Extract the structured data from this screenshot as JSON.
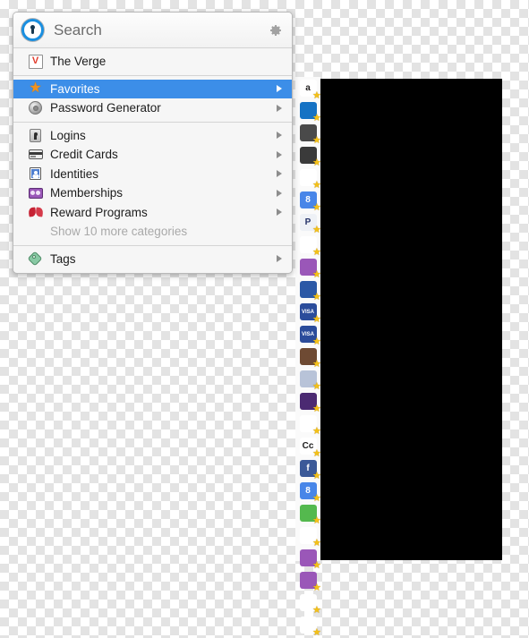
{
  "window": {
    "title": "1Password mini",
    "black_panel_label": "browser-content-area"
  },
  "search": {
    "label": "Search",
    "placeholder": "Search",
    "logo_icon": "1password-logo-icon",
    "settings_icon": "gear-icon"
  },
  "colors": {
    "selection": "#3c8ee8",
    "panel_background": "#f6f6f6",
    "panel_border": "#b9b9b9",
    "muted_text": "#a9a9a9",
    "text": "#1c1c1c",
    "star_badge": "#f5c116"
  },
  "menu": {
    "recent": [
      {
        "label": "The Verge",
        "icon": "verge-icon",
        "has_submenu": false,
        "selected": false
      }
    ],
    "shortcuts": [
      {
        "label": "Favorites",
        "icon": "star-icon",
        "has_submenu": true,
        "selected": true
      },
      {
        "label": "Password Generator",
        "icon": "dial-icon",
        "has_submenu": true,
        "selected": false
      }
    ],
    "categories": [
      {
        "label": "Logins",
        "icon": "lock-icon",
        "has_submenu": true,
        "selected": false
      },
      {
        "label": "Credit Cards",
        "icon": "credit-card-icon",
        "has_submenu": true,
        "selected": false
      },
      {
        "label": "Identities",
        "icon": "identity-icon",
        "has_submenu": true,
        "selected": false
      },
      {
        "label": "Memberships",
        "icon": "membership-icon",
        "has_submenu": true,
        "selected": false
      },
      {
        "label": "Reward Programs",
        "icon": "bow-icon",
        "has_submenu": true,
        "selected": false
      }
    ],
    "show_more": {
      "label": "Show 10 more categories"
    },
    "tags": [
      {
        "label": "Tags",
        "icon": "tag-icon",
        "has_submenu": true,
        "selected": false
      }
    ]
  },
  "icon_strip": {
    "name": "favorites-icon-strip",
    "items": [
      {
        "name": "amazon-icon",
        "glyph": "a",
        "bg": "#ffffff",
        "fg": "#221f1f",
        "favorite": true
      },
      {
        "name": "amex-icon",
        "glyph": "",
        "bg": "#1572c4",
        "fg": "#ffffff",
        "favorite": true
      },
      {
        "name": "apple-store-icon",
        "glyph": "",
        "bg": "#4a4a4a",
        "fg": "#ffffff",
        "favorite": true
      },
      {
        "name": "bank-icon",
        "glyph": "",
        "bg": "#3a3a3a",
        "fg": "#cfd8e0",
        "favorite": true
      },
      {
        "name": "dropbox-icon",
        "glyph": "",
        "bg": "#ffffff",
        "fg": "#2f8fe0",
        "favorite": true
      },
      {
        "name": "google-icon",
        "glyph": "8",
        "bg": "#4886e8",
        "fg": "#ffffff",
        "favorite": true
      },
      {
        "name": "paypal-icon",
        "glyph": "P",
        "bg": "#eef1f6",
        "fg": "#27346a",
        "favorite": true
      },
      {
        "name": "cherry-icon",
        "glyph": "",
        "bg": "#ffffff",
        "fg": "#c2182b",
        "favorite": true
      },
      {
        "name": "membership-icon-1",
        "glyph": "",
        "bg": "#9a57b8",
        "fg": "#f0e2f7",
        "favorite": true
      },
      {
        "name": "discover-card-icon",
        "glyph": "",
        "bg": "#2b58a6",
        "fg": "#ffffff",
        "favorite": true
      },
      {
        "name": "visa-card-icon-1",
        "glyph": "VISA",
        "bg": "#2b4c9b",
        "fg": "#ffffff",
        "favorite": true
      },
      {
        "name": "visa-card-icon-2",
        "glyph": "VISA",
        "bg": "#2b4c9b",
        "fg": "#ffffff",
        "favorite": true
      },
      {
        "name": "portrait-icon",
        "glyph": "",
        "bg": "#6e4a33",
        "fg": "#e8cbb0",
        "favorite": true
      },
      {
        "name": "pie-chart-icon",
        "glyph": "",
        "bg": "#b8c3d8",
        "fg": "#3a8f4a",
        "favorite": true
      },
      {
        "name": "apple-id-icon",
        "glyph": "",
        "bg": "#4b2a72",
        "fg": "#ffffff",
        "favorite": true
      },
      {
        "name": "paper-plane-icon",
        "glyph": "",
        "bg": "#ffffff",
        "fg": "#2f7fd0",
        "favorite": true
      },
      {
        "name": "creative-commons-icon",
        "glyph": "Cc",
        "bg": "#ffffff",
        "fg": "#1d1d1d",
        "favorite": true
      },
      {
        "name": "facebook-icon",
        "glyph": "f",
        "bg": "#3b5998",
        "fg": "#ffffff",
        "favorite": true
      },
      {
        "name": "google-plus-icon",
        "glyph": "8",
        "bg": "#4886e8",
        "fg": "#ffffff",
        "favorite": true
      },
      {
        "name": "messages-icon",
        "glyph": "",
        "bg": "#54b94e",
        "fg": "#ffffff",
        "favorite": true
      },
      {
        "name": "graduation-cap-icon",
        "glyph": "",
        "bg": "#ffffff",
        "fg": "#2d5f8f",
        "favorite": true
      },
      {
        "name": "membership-icon-2",
        "glyph": "",
        "bg": "#9a57b8",
        "fg": "#f0e2f7",
        "favorite": true
      },
      {
        "name": "membership-icon-3",
        "glyph": "",
        "bg": "#9a57b8",
        "fg": "#f0e2f7",
        "favorite": true
      },
      {
        "name": "stop-sign-icon",
        "glyph": "",
        "bg": "#ffffff",
        "fg": "#cf2b2b",
        "favorite": true
      },
      {
        "name": "mountain-icon",
        "glyph": "",
        "bg": "#ffffff",
        "fg": "#4f9ad0",
        "favorite": true
      }
    ]
  }
}
